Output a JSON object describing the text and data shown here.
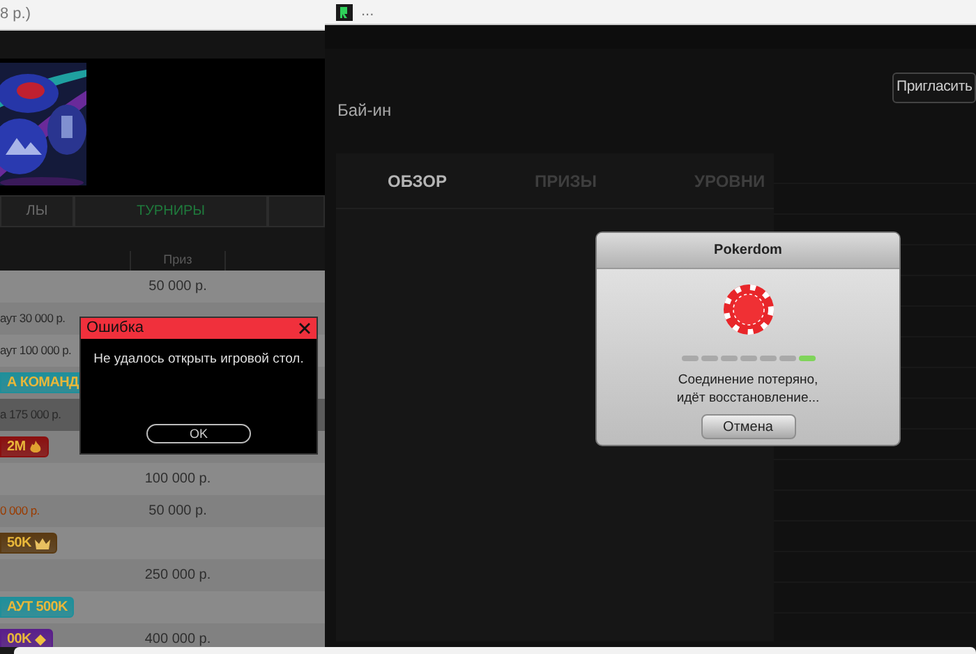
{
  "left_window": {
    "title": "8 р.)",
    "tabs": [
      {
        "label": "ЛЫ",
        "selected": false
      },
      {
        "label": "ТУРНИРЫ",
        "selected": true
      }
    ],
    "prize_column": "Приз",
    "rows": [
      {
        "prize": "50 000 р.",
        "highlighted": false
      },
      {
        "kind": "text",
        "name": "аут 30 000 р.",
        "highlighted": false
      },
      {
        "kind": "text",
        "name": "аут 100 000 р.",
        "highlighted": false
      },
      {
        "kind": "badge",
        "name": "А КОМАНД",
        "color": "#1f8f9a",
        "highlighted": false
      },
      {
        "kind": "text",
        "name": "а 175 000 р.",
        "highlighted": true
      },
      {
        "kind": "fire-badge",
        "name": "2М",
        "color": "#8a1010",
        "highlighted": false
      },
      {
        "prize": "100 000 р.",
        "highlighted": false
      },
      {
        "kind": "promo",
        "name": "0 000 р.",
        "prize": "50 000 р.",
        "highlighted": false
      },
      {
        "kind": "crown-badge",
        "name": "50K",
        "color": "#5a3a12",
        "highlighted": false
      },
      {
        "prize": "250 000 р.",
        "highlighted": false
      },
      {
        "kind": "badge",
        "name": "АУТ 500K",
        "color": "#1f8f9a",
        "highlighted": false
      },
      {
        "kind": "diamond-badge",
        "name": "00K",
        "color": "#5a1f8a",
        "prize": "400 000 р.",
        "highlighted": false
      }
    ],
    "error_dialog": {
      "title": "Ошибка",
      "message": "Не удалось открыть игровой стол.",
      "button": "OK"
    }
  },
  "right_window": {
    "title": "...",
    "invite_button": "Пригласить",
    "buyin_label": "Бай-ин",
    "tabs": [
      {
        "label": "ОБЗОР",
        "selected": true
      },
      {
        "label": "ПРИЗЫ",
        "selected": false
      },
      {
        "label": "УРОВНИ",
        "selected": false
      }
    ],
    "connection_dialog": {
      "title": "Pokerdom",
      "segments": [
        {
          "active": false
        },
        {
          "active": false
        },
        {
          "active": false
        },
        {
          "active": false
        },
        {
          "active": false
        },
        {
          "active": false
        },
        {
          "active": true
        }
      ],
      "message_lines": [
        "Соединение потеряно,",
        "идёт восстановление..."
      ],
      "button": "Отмена"
    }
  }
}
